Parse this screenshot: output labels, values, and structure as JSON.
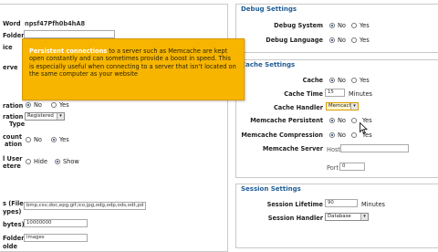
{
  "left": {
    "secret_word_label": "Word",
    "secret_word_value": "npsf47Pfh0b4hA8",
    "rows": [
      {
        "label": "Folder"
      },
      {
        "label": "ice"
      },
      {
        "label": "erve"
      }
    ],
    "compression": {
      "label": "ration",
      "yes": "Yes",
      "no": "No"
    },
    "type": {
      "label_1": "ration",
      "label_2": "Type",
      "value": "Registered"
    },
    "account": {
      "label_1": "count",
      "label_2": "ation",
      "yes": "Yes",
      "no": "No"
    },
    "user": {
      "label_1": "l User",
      "label_2": "etere",
      "hide": "Hide",
      "show": "Show"
    },
    "file_types": {
      "label_1": "s (File",
      "label_2": "ypes)",
      "value": "bmp,csv,doc,epg,gif,ico,jpg,odg,odp,ods,odt,pd"
    },
    "max_size": {
      "label": "bytes)",
      "value": "10000000"
    },
    "folder": {
      "label": "Folder",
      "value": "images"
    },
    "last": {
      "label": "olde"
    }
  },
  "tooltip": {
    "title": "Persistent connections",
    "body": " to a server such as Memcache are kept open constantly and can sometimes provide a boost in speed. This is especially useful when connecting to a server that isn't located on the same computer as your website"
  },
  "debug": {
    "title": "Debug Settings",
    "system_label": "Debug System",
    "language_label": "Debug Language",
    "no": "No",
    "yes": "Yes"
  },
  "cache": {
    "title": "Cache Settings",
    "cache_label": "Cache",
    "time_label": "Cache Time",
    "time_value": "15",
    "time_unit": "Minutes",
    "handler_label": "Cache Handler",
    "handler_value": "Memcache",
    "persistent_label": "Memcache Persistent",
    "compression_label": "Memcache Compression",
    "server_label": "Memcache Server",
    "host_label": "Host",
    "port_label": "Port",
    "port_value": "0",
    "no": "No",
    "yes": "Yes"
  },
  "session": {
    "title": "Session Settings",
    "lifetime_label": "Session Lifetime",
    "lifetime_value": "90",
    "lifetime_unit": "Minutes",
    "handler_label": "Session Handler",
    "handler_value": "Database"
  },
  "colors": {
    "section_title": "#1e5c96",
    "tooltip_bg": "#f7b500",
    "tooltip_title": "#ffffff"
  },
  "icons": [
    "radio-selected-icon",
    "radio-empty-icon",
    "dropdown-arrow-icon",
    "mouse-pointer-icon"
  ]
}
